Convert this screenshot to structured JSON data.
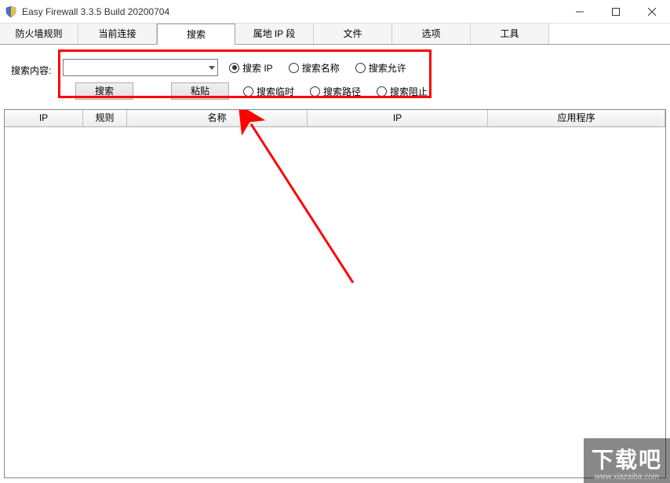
{
  "window": {
    "title": "Easy Firewall 3.3.5 Build 20200704"
  },
  "tabs": {
    "firewall_rules": "防火墙规则",
    "current_conn": "当前连接",
    "search": "搜索",
    "ip_segment": "属地 IP 段",
    "file": "文件",
    "options": "选项",
    "tools": "工具"
  },
  "search": {
    "label": "搜索内容:",
    "combo_value": "",
    "btn_search": "搜索",
    "btn_paste": "粘贴",
    "radios_row1": {
      "search_ip": "搜索 IP",
      "search_name": "搜索名称",
      "search_allow": "搜索允许"
    },
    "radios_row2": {
      "search_temp": "搜索临时",
      "search_path": "搜索路径",
      "search_block": "搜索阻止"
    },
    "selected": "search_ip"
  },
  "table": {
    "columns": {
      "ip1": "IP",
      "rule": "规则",
      "name": "名称",
      "ip2": "IP",
      "app": "应用程序"
    },
    "rows": []
  },
  "watermark": {
    "text": "下载吧",
    "url": "www.xiazaiba.com"
  }
}
